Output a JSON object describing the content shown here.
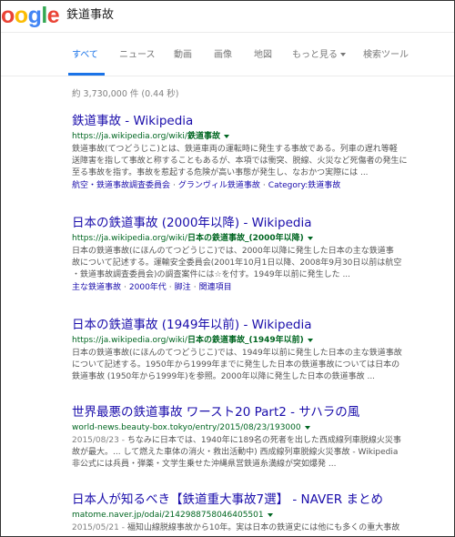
{
  "search": {
    "logo_letters": [
      "o",
      "o",
      "g",
      "l",
      "e"
    ],
    "logo_colors": [
      "#ea4335",
      "#fbbc05",
      "#4285f4",
      "#34a853",
      "#ea4335"
    ],
    "query": "鉄道事故"
  },
  "tabs": [
    {
      "label": "すべて"
    },
    {
      "label": "ニュース"
    },
    {
      "label": "動画"
    },
    {
      "label": "画像"
    },
    {
      "label": "地図"
    },
    {
      "label": "もっと見る"
    },
    {
      "label": "検索ツール"
    }
  ],
  "stats": "約 3,730,000 件 (0.44 秒)",
  "results": [
    {
      "title": "鉄道事故 - Wikipedia",
      "url_pre": "https://ja.wikipedia.org/wiki/",
      "url_bold": "鉄道事故",
      "snippet": [
        "鉄道事故(てつどうじこ)とは、鉄道車両の運転時に発生する事故である。列車の遅れ等軽",
        "送障害を指して事故と称することもあるが、本項では衝突、脱線、火災など死傷者の発生に",
        "至る事故を指す。事故を惹起する危険が高い事態が発生し、なおかつ実際には ..."
      ],
      "links": [
        "航空・鉄道事故調査委員会",
        "グランヴィル鉄道事故",
        "Category:鉄道事故"
      ]
    },
    {
      "title": "日本の鉄道事故 (2000年以降) - Wikipedia",
      "url_pre": "https://ja.wikipedia.org/wiki/",
      "url_bold": "日本の鉄道事故_(2000年以降)",
      "snippet": [
        "日本の鉄道事故(にほんのてつどうじこ)では、2000年以降に発生した日本の主な鉄道事",
        "故について記述する。運輸安全委員会(2001年10月1日以降、2008年9月30日以前は航空",
        "・鉄道事故調査委員会)の調査案件には☆を付す。1949年以前に発生した ..."
      ],
      "links": [
        "主な鉄道事故",
        "2000年代",
        "脚注",
        "関連項目"
      ]
    },
    {
      "title": "日本の鉄道事故 (1949年以前) - Wikipedia",
      "url_pre": "https://ja.wikipedia.org/wiki/",
      "url_bold": "日本の鉄道事故_(1949年以前)",
      "snippet": [
        "日本の鉄道事故(にほんのてつどうじこ)では、1949年以前に発生した日本の主な鉄道事故",
        "について記述する。1950年から1999年までに発生した日本の鉄道事故については日本の",
        "鉄道事故 (1950年から1999年)を参照。2000年以降に発生した日本の鉄道事故 ..."
      ],
      "links": []
    },
    {
      "title": "世界最悪の鉄道事故 ワースト20 Part2 - サハラの風",
      "url_pre": "world-news.beauty-box.tokyo/entry/2015/08/23/193000",
      "url_bold": "",
      "date": "2015/08/23 - ",
      "snippet": [
        "ちなみに日本では、1940年に189名の死者を出した西成線列車脱線火災事",
        "故が最大。... して燃えた車体の消火・救出活動中) 西成線列車脱線火災事故 - Wikipedia",
        "非公式には兵員・弾薬・文学生乗せた沖縄県営鉄道糸満線が突如爆発 ..."
      ],
      "links": []
    },
    {
      "title": "日本人が知るべき【鉄道重大事故7選】 - NAVER まとめ",
      "url_pre": "matome.naver.jp/odai/2142988758046405501",
      "url_bold": "",
      "date": "2015/05/21 - ",
      "snippet": [
        "福知山線脱線事故から10年。実は日本の鉄道史には他にも多くの重大事故"
      ],
      "links": []
    }
  ]
}
